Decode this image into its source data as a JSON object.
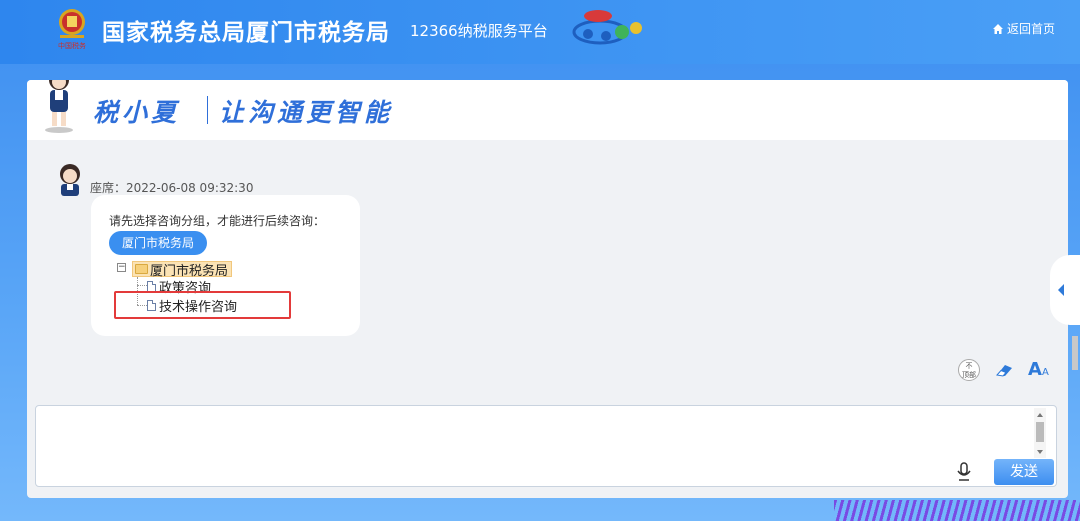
{
  "header": {
    "title": "国家税务总局厦门市税务局",
    "subtitle": "12366纳税服务平台",
    "emblem_caption": "中国税务",
    "home_link": "返回首页"
  },
  "banner": {
    "brand": "税小夏",
    "slogan": "让沟通更智能"
  },
  "message": {
    "sender_line": "座席：2022-06-08 09:32:30",
    "prompt": "请先选择咨询分组，才能进行后续咨询：",
    "group_button": "厦门市税务局",
    "tree": {
      "toggle": "−",
      "root": "厦门市税务局",
      "children": [
        "政策咨询",
        "技术操作咨询"
      ]
    }
  },
  "tools": {
    "top_label_1": "不",
    "top_label_2": "顶部",
    "font_label": "A"
  },
  "composer": {
    "input_value": "",
    "send_label": "发送"
  }
}
